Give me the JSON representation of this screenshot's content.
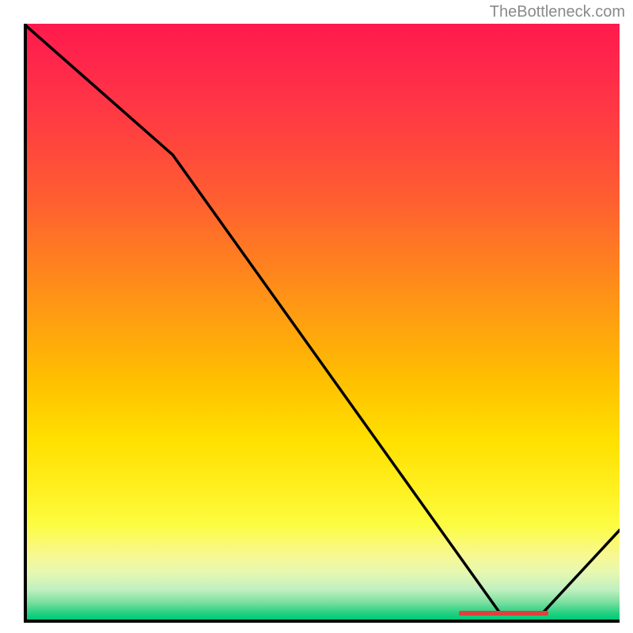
{
  "attribution": "TheBottleneck.com",
  "chart_data": {
    "type": "line",
    "x": [
      0,
      0.25,
      0.8,
      0.87,
      1.0
    ],
    "values": [
      100,
      78,
      1,
      1,
      15
    ],
    "ylim": [
      0,
      100
    ],
    "xlim": [
      0,
      1
    ],
    "marker": {
      "x_start": 0.73,
      "x_end": 0.88,
      "y": 1
    },
    "title": "",
    "xlabel": "",
    "ylabel": ""
  },
  "colors": {
    "gradient_top": "#ff1a4d",
    "gradient_bottom": "#00c878",
    "line": "#000000",
    "marker": "#e04040",
    "axis": "#000000"
  }
}
